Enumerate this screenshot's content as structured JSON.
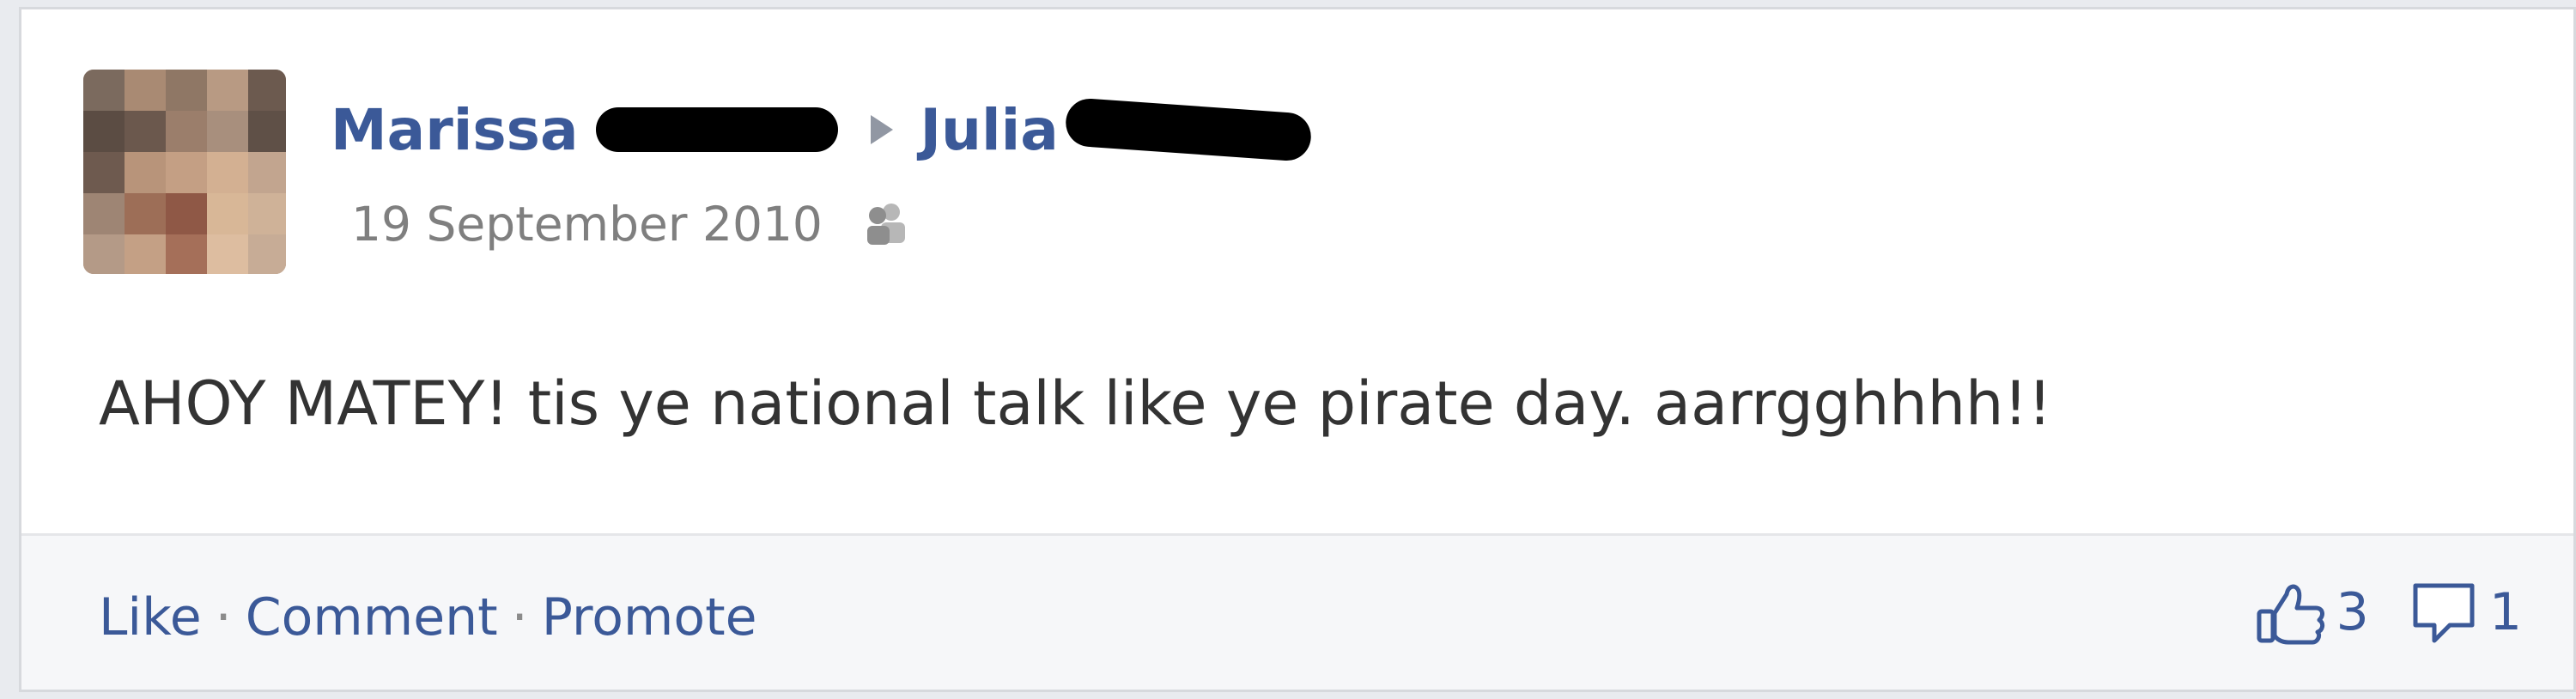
{
  "post": {
    "author_name": "Marissa",
    "recipient_name": "Julia",
    "date": "19 September 2010",
    "status": "AHOY MATEY! tis ye national talk like ye pirate day. aarrgghhhh!!",
    "icons": {
      "avatar": "profile-photo-pixelated",
      "arrow": "right-arrow-icon",
      "audience": "friends-icon"
    }
  },
  "footer": {
    "actions": [
      "Like",
      "Comment",
      "Promote"
    ],
    "separator": "·",
    "like_count": "3",
    "comment_count": "1",
    "icons": {
      "like": "thumbs-up-icon",
      "comment": "comment-bubble-icon"
    }
  },
  "colors": {
    "link": "#3b5998",
    "muted": "#7f7f7f",
    "text": "#333333",
    "background": "#ffffff",
    "footer_background": "#f6f7f9"
  }
}
